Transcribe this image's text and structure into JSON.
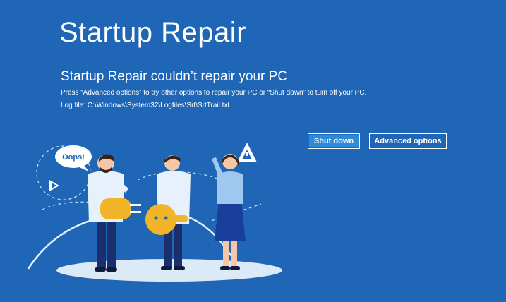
{
  "screen": {
    "title": "Startup Repair",
    "heading": "Startup Repair couldn’t repair your PC",
    "message": "Press “Advanced options” to try other options to repair your PC or “Shut down” to turn off your PC.",
    "log_file": "Log file: C:\\Windows\\System32\\Logfiles\\Srt\\SrtTrail.txt"
  },
  "buttons": {
    "shut_down": "Shut down",
    "advanced_options": "Advanced options"
  },
  "illustration": {
    "speech_bubble": "Oops!"
  },
  "colors": {
    "background": "#1f66b6",
    "accent_button": "#2d8bd9",
    "plug": "#f2b52a",
    "shirt": "#e6f1fb",
    "pants": "#1a2f6b"
  }
}
